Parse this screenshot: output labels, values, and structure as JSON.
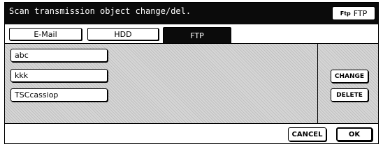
{
  "title": "Scan transmission object change/del.",
  "mode_badge": {
    "icon_text": "Ftp",
    "label": "FTP",
    "icon": "ftp-icon"
  },
  "tabs": [
    {
      "label": "E-Mail",
      "active": false
    },
    {
      "label": "HDD",
      "active": false
    },
    {
      "label": "FTP",
      "active": true
    }
  ],
  "entries": [
    "abc",
    "kkk",
    "TSCcassiop"
  ],
  "side_buttons": {
    "change": "CHANGE",
    "delete": "DELETE"
  },
  "footer": {
    "cancel": "CANCEL",
    "ok": "OK"
  }
}
